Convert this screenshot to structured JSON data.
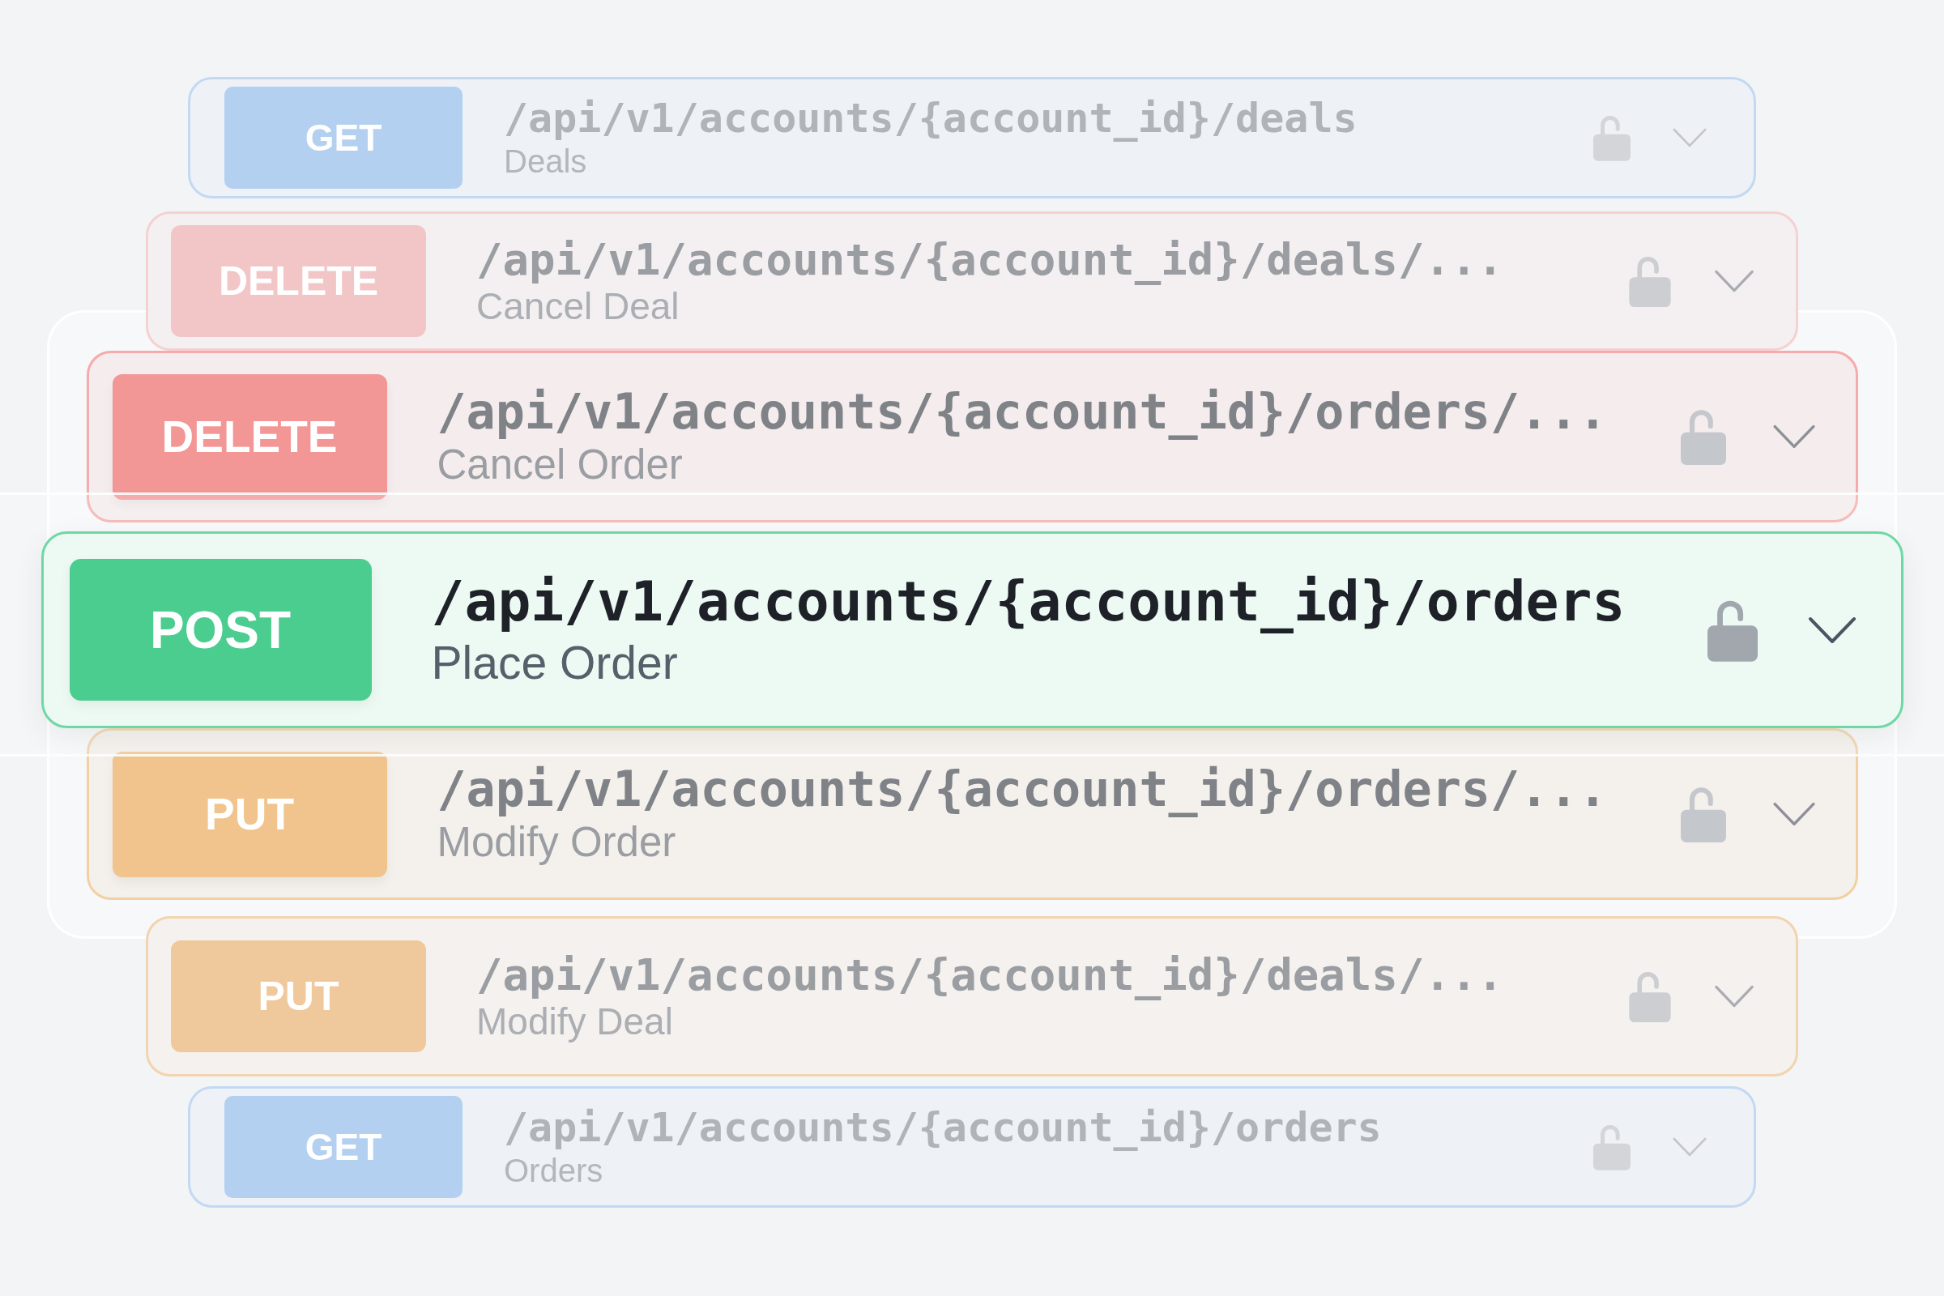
{
  "endpoints": [
    {
      "method": "GET",
      "path": "/api/v1/accounts/{account_id}/deals",
      "summary": "Deals",
      "color": "#b4d0f0",
      "selected": false,
      "expanded": false
    },
    {
      "method": "DELETE",
      "path": "/api/v1/accounts/{account_id}/deals/...",
      "summary": "Cancel Deal",
      "color": "#f2c6c6",
      "selected": false,
      "expanded": false
    },
    {
      "method": "DELETE",
      "path": "/api/v1/accounts/{account_id}/orders/...",
      "summary": "Cancel Order",
      "color": "#f29696",
      "selected": false,
      "expanded": false
    },
    {
      "method": "POST",
      "path": "/api/v1/accounts/{account_id}/orders",
      "summary": "Place Order",
      "color": "#4bcd8f",
      "selected": true,
      "expanded": false
    },
    {
      "method": "PUT",
      "path": "/api/v1/accounts/{account_id}/orders/...",
      "summary": "Modify Order",
      "color": "#f0c48c",
      "selected": false,
      "expanded": false
    },
    {
      "method": "PUT",
      "path": "/api/v1/accounts/{account_id}/deals/...",
      "summary": "Modify Deal",
      "color": "#efc99c",
      "selected": false,
      "expanded": false
    },
    {
      "method": "GET",
      "path": "/api/v1/accounts/{account_id}/orders",
      "summary": "Orders",
      "color": "#b4d0f0",
      "selected": false,
      "expanded": false
    }
  ]
}
